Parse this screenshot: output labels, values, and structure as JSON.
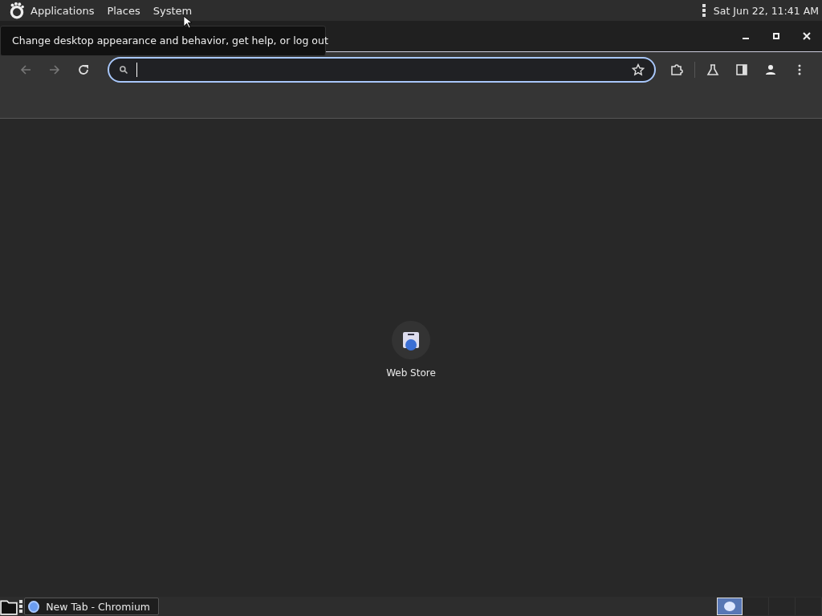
{
  "top_panel": {
    "menus": [
      {
        "label": "Applications"
      },
      {
        "label": "Places"
      },
      {
        "label": "System"
      }
    ],
    "clock": "Sat Jun 22, 11:41 AM"
  },
  "tooltip": "Change desktop appearance and behavior, get help, or log out",
  "shortcuts": [
    {
      "label": "Web Store"
    }
  ],
  "taskbar": {
    "windows": [
      {
        "label": "New Tab - Chromium",
        "selected": false
      }
    ],
    "workspaces": [
      {
        "selected": true
      },
      {
        "selected": false
      },
      {
        "selected": false
      },
      {
        "selected": false
      }
    ]
  }
}
